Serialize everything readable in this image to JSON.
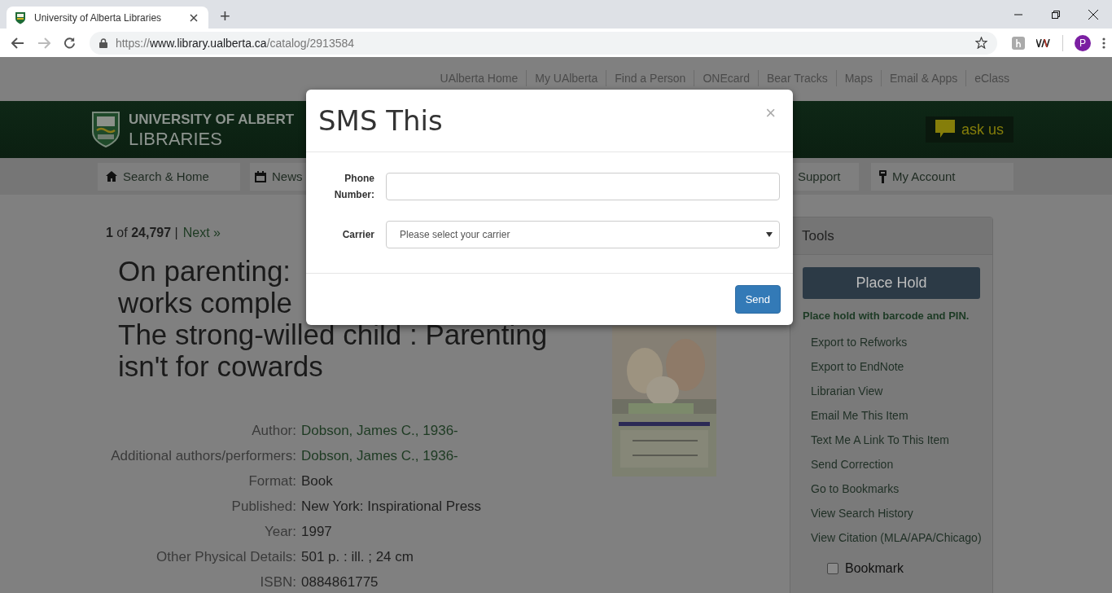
{
  "browser": {
    "tab_title": "University of Alberta Libraries",
    "new_tab": "+",
    "url": {
      "scheme": "https://",
      "host": "www.library.ualberta.ca",
      "path": "/catalog/2913584"
    },
    "avatar": "P"
  },
  "site": {
    "top_links": [
      "UAlberta Home",
      "My UAlberta",
      "Find a Person",
      "ONEcard",
      "Bear Tracks",
      "Maps",
      "Email & Apps",
      "eClass"
    ],
    "logo": {
      "line1": "UNIVERSITY OF ALBERT",
      "line2": "LIBRARIES"
    },
    "ask_us": "ask us",
    "nav": [
      {
        "label": "Search & Home",
        "kind": "home"
      },
      {
        "label": "News",
        "kind": "calendar"
      },
      {
        "label": "Support",
        "kind": "plain"
      },
      {
        "label": "My Account",
        "kind": "key"
      }
    ]
  },
  "record": {
    "pager": "**1** of **24,797** |",
    "next": "Next »",
    "title_lines": [
      "On parenting:",
      "works comple",
      "The strong-willed child : Parenting",
      "isn't for cowards"
    ],
    "details": [
      {
        "label": "Author:",
        "value": "Dobson, James C., 1936-",
        "link": true
      },
      {
        "label": "Additional authors/performers:",
        "value": "Dobson, James C., 1936-",
        "link": true
      },
      {
        "label": "Format:",
        "value": "Book",
        "link": false
      },
      {
        "label": "Published:",
        "value": "New York: Inspirational Press",
        "link": false
      },
      {
        "label": "Year:",
        "value": "1997",
        "link": false
      },
      {
        "label": "Other Physical Details:",
        "value": "501 p. : ill. ; 24 cm",
        "link": false
      },
      {
        "label": "ISBN:",
        "value": "0884861775",
        "link": false
      }
    ]
  },
  "tools": {
    "heading": "Tools",
    "hold_button": "Place Hold",
    "hold_note": "Place hold with barcode and PIN.",
    "links": [
      "Export to Refworks",
      "Export to EndNote",
      "Librarian View",
      "Email Me This Item",
      "Text Me A Link To This Item",
      "Send Correction",
      "Go to Bookmarks",
      "View Search History",
      "View Citation (MLA/APA/Chicago)"
    ],
    "bookmark": {
      "label": "Bookmark",
      "checked": false
    }
  },
  "modal": {
    "title": "SMS This",
    "close": "×",
    "fields": [
      {
        "kind": "text",
        "label": "Phone Number:"
      },
      {
        "kind": "select",
        "label": "Carrier",
        "value": "Please select your carrier"
      }
    ],
    "send": "Send"
  }
}
